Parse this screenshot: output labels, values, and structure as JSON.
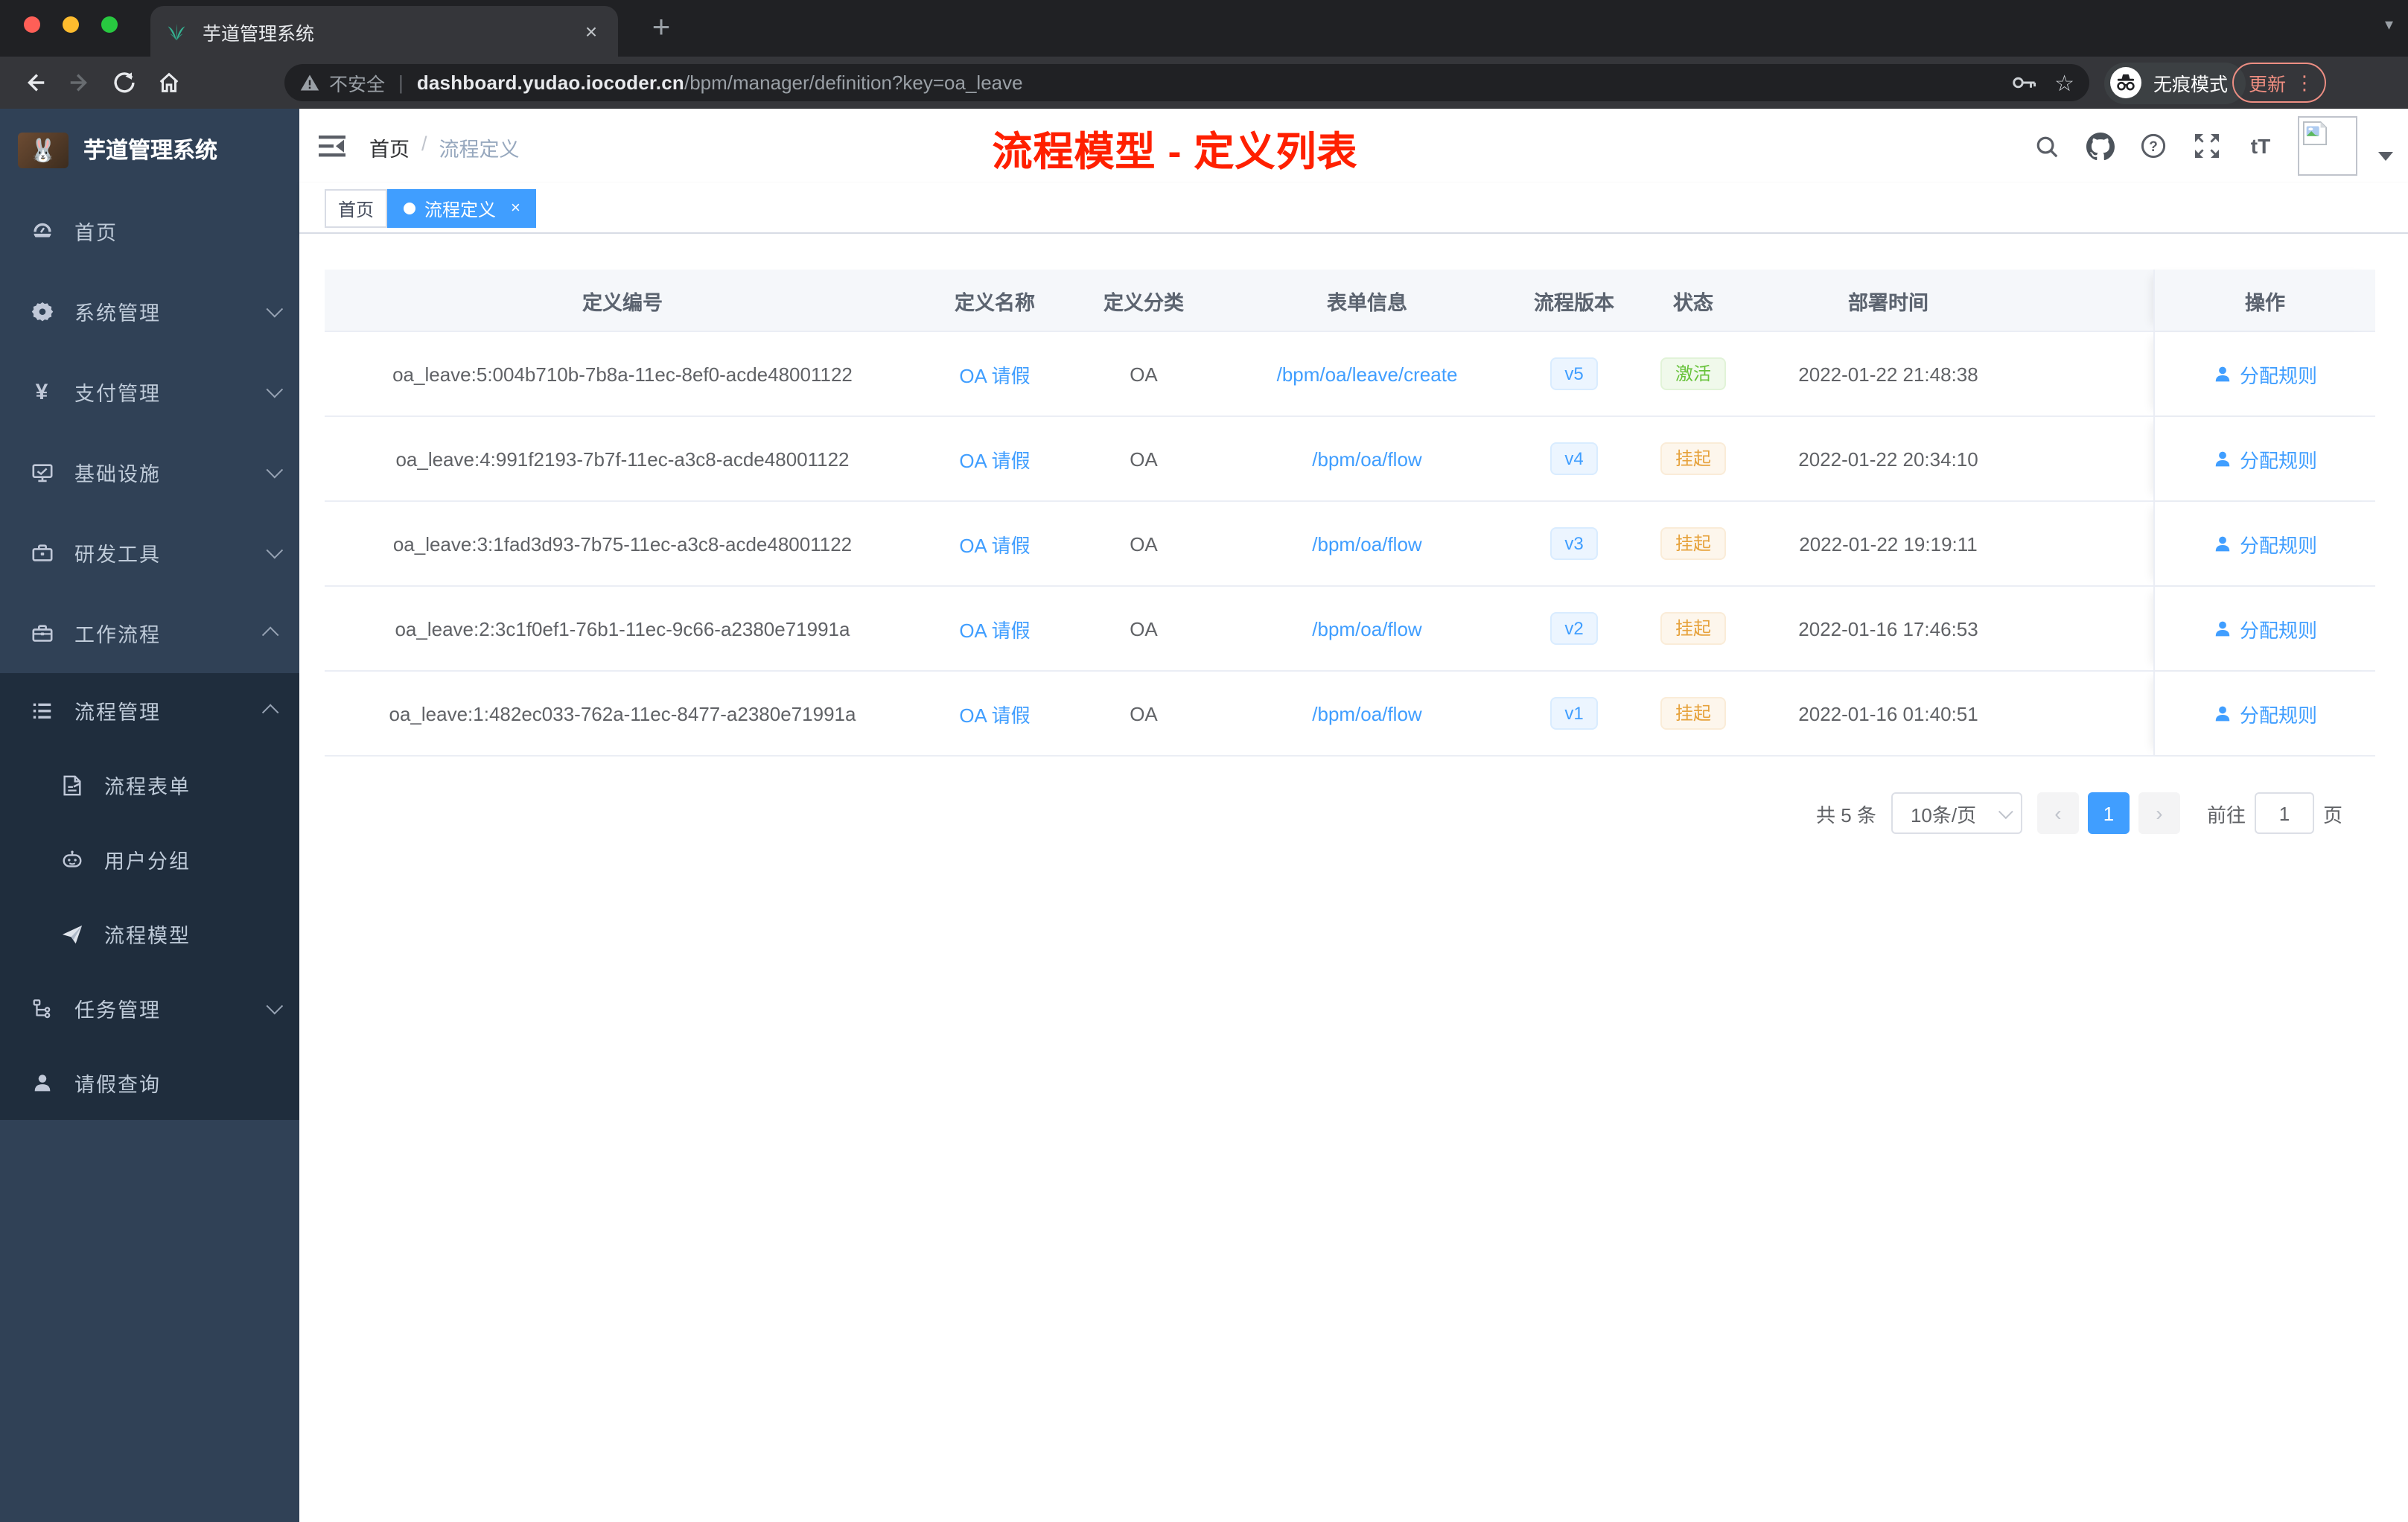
{
  "browser": {
    "tab": {
      "title": "芋道管理系统",
      "close": "×",
      "new_tab": "+"
    },
    "address": {
      "security": "不安全",
      "host": "dashboard.yudao.iocoder.cn",
      "path": "/bpm/manager/definition?key=oa_leave"
    },
    "incognito_label": "无痕模式",
    "update_label": "更新",
    "kebab": "⋮"
  },
  "sidebar": {
    "logo_title": "芋道管理系统",
    "items": [
      {
        "label": "首页"
      },
      {
        "label": "系统管理"
      },
      {
        "label": "支付管理"
      },
      {
        "label": "基础设施"
      },
      {
        "label": "研发工具"
      },
      {
        "label": "工作流程"
      }
    ],
    "submenu": [
      {
        "label": "流程管理"
      },
      {
        "label": "流程表单"
      },
      {
        "label": "用户分组"
      },
      {
        "label": "流程模型"
      },
      {
        "label": "任务管理"
      },
      {
        "label": "请假查询"
      }
    ]
  },
  "navbar": {
    "breadcrumb": {
      "home": "首页",
      "separator": "/",
      "current": "流程定义"
    },
    "annotation": "流程模型 - 定义列表"
  },
  "tags": {
    "home": "首页",
    "active": "流程定义",
    "close": "×"
  },
  "table": {
    "headers": {
      "id": "定义编号",
      "name": "定义名称",
      "category": "定义分类",
      "form": "表单信息",
      "version": "流程版本",
      "status": "状态",
      "time": "部署时间",
      "op": "操作"
    },
    "action_label": "分配规则",
    "rows": [
      {
        "id": "oa_leave:5:004b710b-7b8a-11ec-8ef0-acde48001122",
        "name": "OA 请假",
        "category": "OA",
        "form": "/bpm/oa/leave/create",
        "version": "v5",
        "status": "激活",
        "status_type": "success",
        "time": "2022-01-22 21:48:38",
        "action": "分配规则"
      },
      {
        "id": "oa_leave:4:991f2193-7b7f-11ec-a3c8-acde48001122",
        "name": "OA 请假",
        "category": "OA",
        "form": "/bpm/oa/flow",
        "version": "v4",
        "status": "挂起",
        "status_type": "warning",
        "time": "2022-01-22 20:34:10",
        "action": "分配规则"
      },
      {
        "id": "oa_leave:3:1fad3d93-7b75-11ec-a3c8-acde48001122",
        "name": "OA 请假",
        "category": "OA",
        "form": "/bpm/oa/flow",
        "version": "v3",
        "status": "挂起",
        "status_type": "warning",
        "time": "2022-01-22 19:19:11",
        "action": "分配规则"
      },
      {
        "id": "oa_leave:2:3c1f0ef1-76b1-11ec-9c66-a2380e71991a",
        "name": "OA 请假",
        "category": "OA",
        "form": "/bpm/oa/flow",
        "version": "v2",
        "status": "挂起",
        "status_type": "warning",
        "time": "2022-01-16 17:46:53",
        "action": "分配规则"
      },
      {
        "id": "oa_leave:1:482ec033-762a-11ec-8477-a2380e71991a",
        "name": "OA 请假",
        "category": "OA",
        "form": "/bpm/oa/flow",
        "version": "v1",
        "status": "挂起",
        "status_type": "warning",
        "time": "2022-01-16 01:40:51",
        "action": "分配规则"
      }
    ]
  },
  "pagination": {
    "total": "共 5 条",
    "page_size": "10条/页",
    "prev": "‹",
    "page": "1",
    "next": "›",
    "goto": "前往",
    "goto_value": "1",
    "unit": "页"
  },
  "colors": {
    "primary": "#409eff",
    "success": "#67c23a",
    "warning": "#e6a23c",
    "sidebar": "#304156",
    "sidebar_sub": "#1f2d3d",
    "annotation": "#ff2000"
  }
}
